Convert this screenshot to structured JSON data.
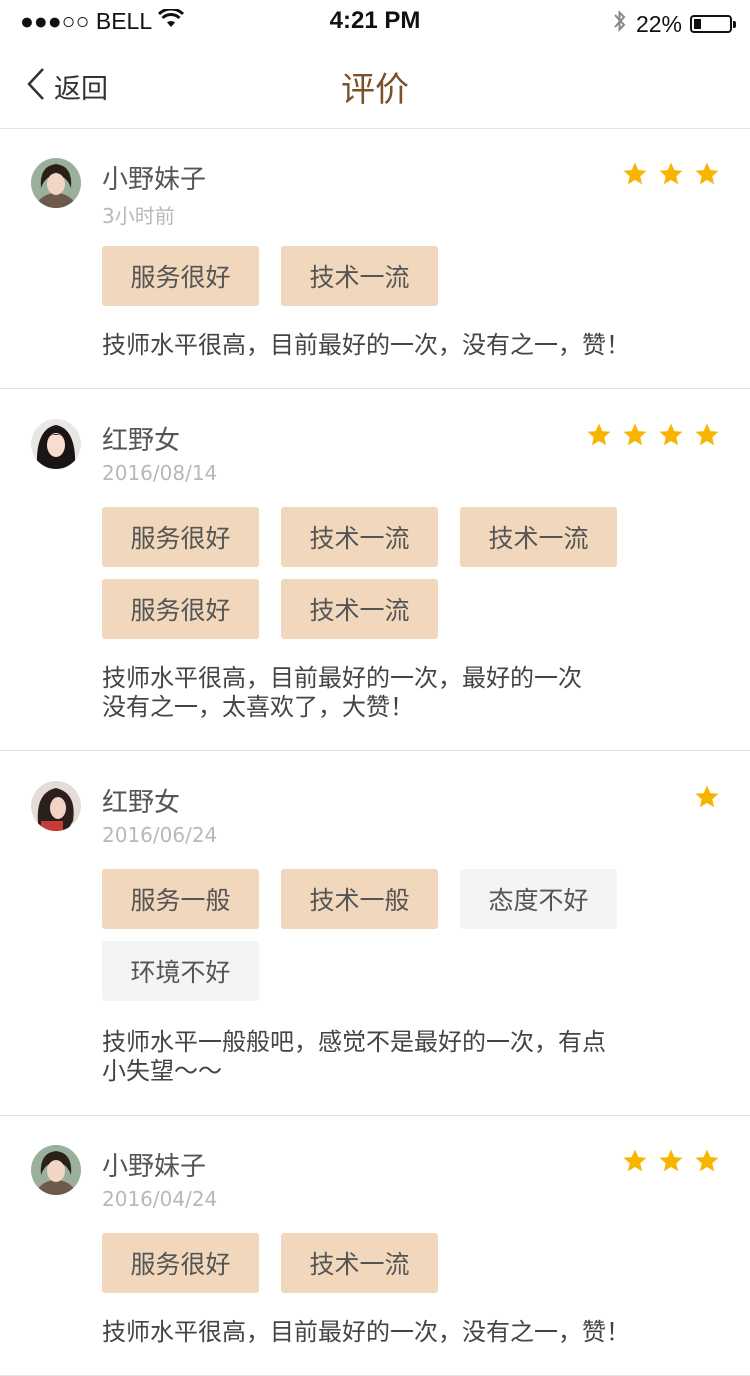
{
  "status_bar": {
    "carrier": "●●●○○ BELL",
    "time": "4:21 PM",
    "battery": "22%",
    "battery_level": 0.22
  },
  "nav": {
    "back_label": "返回",
    "title": "评价"
  },
  "colors": {
    "title": "#7a5128",
    "tag_positive": "#f1d7bb",
    "tag_negative": "#f4f4f4",
    "star": "#f7b500"
  },
  "reviews": [
    {
      "name": "小野妹子",
      "date": "3小时前",
      "rating": 3,
      "tags": [
        {
          "label": "服务很好",
          "type": "positive"
        },
        {
          "label": "技术一流",
          "type": "positive"
        }
      ],
      "comment": [
        "技师水平很高，目前最好的一次，没有之一，赞！"
      ]
    },
    {
      "name": "红野女",
      "date": "2016/08/14",
      "rating": 4,
      "tags": [
        {
          "label": "服务很好",
          "type": "positive"
        },
        {
          "label": "技术一流",
          "type": "positive"
        },
        {
          "label": "技术一流",
          "type": "positive"
        },
        {
          "label": "服务很好",
          "type": "positive"
        },
        {
          "label": "技术一流",
          "type": "positive"
        }
      ],
      "comment": [
        "技师水平很高，目前最好的一次，最好的一次",
        "没有之一，太喜欢了，大赞！"
      ]
    },
    {
      "name": "红野女",
      "date": "2016/06/24",
      "rating": 1,
      "tags": [
        {
          "label": "服务一般",
          "type": "positive"
        },
        {
          "label": "技术一般",
          "type": "positive"
        },
        {
          "label": "态度不好",
          "type": "negative"
        },
        {
          "label": "环境不好",
          "type": "negative"
        }
      ],
      "comment": [
        "技师水平一般般吧，感觉不是最好的一次，有点",
        "小失望～～"
      ]
    },
    {
      "name": "小野妹子",
      "date": "2016/04/24",
      "rating": 3,
      "tags": [
        {
          "label": "服务很好",
          "type": "positive"
        },
        {
          "label": "技术一流",
          "type": "positive"
        }
      ],
      "comment": [
        "技师水平很高，目前最好的一次，没有之一，赞！"
      ]
    }
  ]
}
